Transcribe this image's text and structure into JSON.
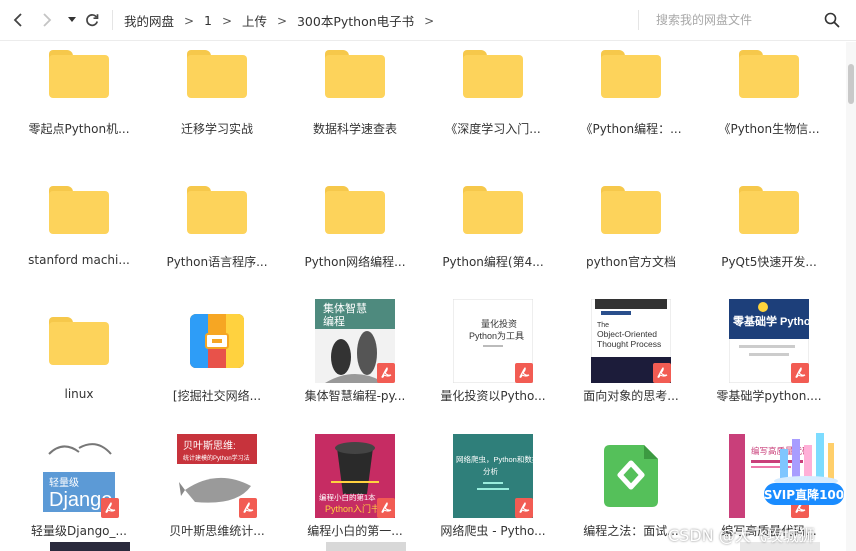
{
  "toolbar": {
    "breadcrumb": [
      "我的网盘",
      "1",
      "上传",
      "300本Python电子书"
    ],
    "separator": ">",
    "search_placeholder": "搜索我的网盘文件"
  },
  "icons": {
    "back": "chevron-left-icon",
    "forward": "chevron-right-icon",
    "history": "caret-down-icon",
    "refresh": "refresh-icon",
    "search": "search-icon",
    "pdf": "pdf-icon"
  },
  "colors": {
    "folder": "#fdd35b",
    "pdf_badge": "#f25c53",
    "svip": "#1a8cff",
    "text": "#333333"
  },
  "files": [
    {
      "name": "零起点Python机...",
      "type": "folder"
    },
    {
      "name": "迁移学习实战",
      "type": "folder"
    },
    {
      "name": "数据科学速查表",
      "type": "folder"
    },
    {
      "name": "《深度学习入门...",
      "type": "folder"
    },
    {
      "name": "《Python编程：...",
      "type": "folder"
    },
    {
      "name": "《Python生物信...",
      "type": "folder"
    },
    {
      "name": "stanford machi...",
      "type": "folder"
    },
    {
      "name": "Python语言程序...",
      "type": "folder"
    },
    {
      "name": "Python网络编程...",
      "type": "folder"
    },
    {
      "name": "Python编程(第4...",
      "type": "folder"
    },
    {
      "name": "python官方文档",
      "type": "folder"
    },
    {
      "name": "PyQt5快速开发...",
      "type": "folder"
    },
    {
      "name": "linux",
      "type": "folder"
    },
    {
      "name": "[挖掘社交网络...",
      "type": "archive"
    },
    {
      "name": "集体智慧编程-py...",
      "type": "pdf",
      "cover_text": [
        "集体智慧",
        "编程"
      ]
    },
    {
      "name": "量化投资以Pytho...",
      "type": "pdf",
      "cover_text": [
        "量化投资",
        "Python为工具"
      ]
    },
    {
      "name": "面向对象的思考...",
      "type": "pdf",
      "cover_text": [
        "The",
        "Object-Oriented",
        "Thought Process"
      ]
    },
    {
      "name": "零基础学python....",
      "type": "pdf",
      "cover_text": [
        "零基础学 Python"
      ]
    },
    {
      "name": "轻量级Django_...",
      "type": "pdf",
      "cover_text": [
        "轻量级",
        "Django"
      ]
    },
    {
      "name": "贝叶斯思维统计...",
      "type": "pdf",
      "cover_text": [
        "贝叶斯思维:",
        "统计建模的Python学习法"
      ]
    },
    {
      "name": "编程小白的第一...",
      "type": "pdf",
      "cover_text": [
        "编程小白的第1本",
        "Python入门书"
      ]
    },
    {
      "name": "网络爬虫 - Pytho...",
      "type": "pdf",
      "cover_text": [
        "网络爬虫，Python和数据",
        "分析"
      ]
    },
    {
      "name": "编程之法：面试...",
      "type": "epub"
    },
    {
      "name": "编写高质量代码...",
      "type": "pdf",
      "cover_text": [
        "编写高质量代码"
      ]
    }
  ],
  "promo": {
    "label": "SVIP直降100"
  },
  "watermark": "CSDN @大飞攻城狮"
}
